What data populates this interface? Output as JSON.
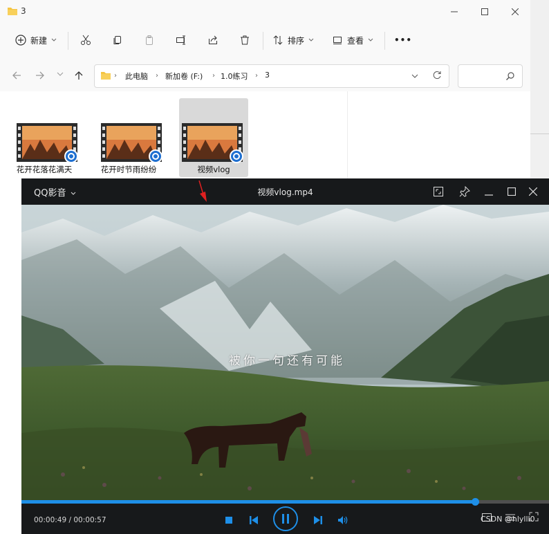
{
  "explorer": {
    "title": "3",
    "toolbar": {
      "new_label": "新建",
      "sort_label": "排序",
      "view_label": "查看",
      "more_label": "•••"
    },
    "breadcrumb": [
      "此电脑",
      "新加卷 (F:)",
      "1.0练习",
      "3"
    ],
    "files": [
      {
        "name": "花开花落花满天",
        "selected": false
      },
      {
        "name": "花开时节雨纷纷",
        "selected": false
      },
      {
        "name": "视频vlog",
        "selected": true
      }
    ]
  },
  "player": {
    "app_label": "QQ影音",
    "video_title": "视频vlog.mp4",
    "subtitle": "被你一句还有可能",
    "time_current": "00:00:49",
    "time_total": "00:00:57",
    "time_display": "00:00:49 / 00:00:57",
    "progress_fraction": 0.86,
    "watermark": "CSDN @hlylll0"
  },
  "colors": {
    "accent": "#1e8fe8",
    "player_bg": "#17191b",
    "selected_file_bg": "#d9d9d9",
    "folder_yellow": "#f5c542"
  },
  "icons": [
    "folder-icon",
    "minimize-icon",
    "maximize-icon",
    "close-icon",
    "new-icon",
    "cut-icon",
    "copy-icon",
    "paste-icon",
    "rename-icon",
    "share-icon",
    "delete-icon",
    "sort-icon",
    "view-icon",
    "back-arrow-icon",
    "forward-arrow-icon",
    "up-arrow-icon",
    "refresh-icon",
    "search-icon",
    "stop-icon",
    "previous-icon",
    "pause-icon",
    "next-icon",
    "volume-icon",
    "pin-icon",
    "screenshot-icon"
  ]
}
